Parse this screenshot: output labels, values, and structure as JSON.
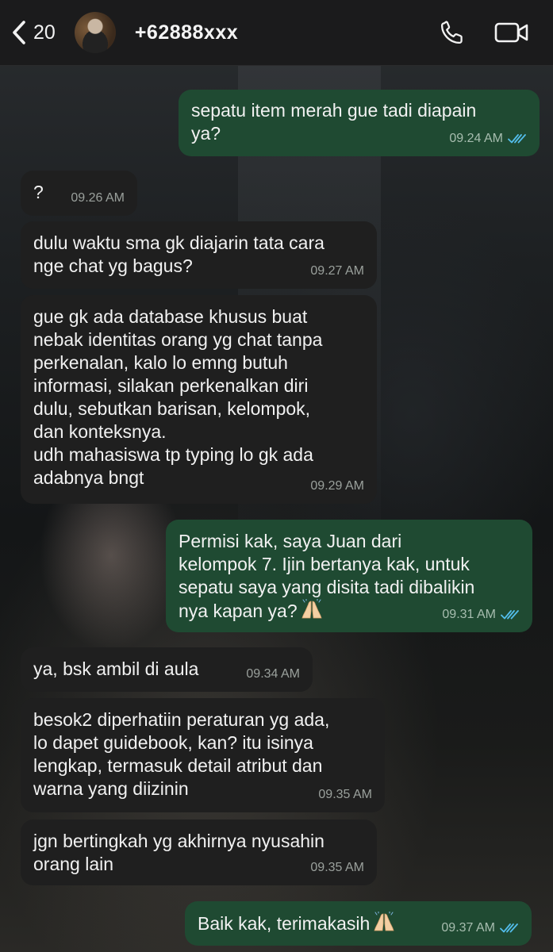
{
  "header": {
    "back_count": "20",
    "contact_name": "+62888xxx"
  },
  "messages": [
    {
      "direction": "out",
      "text": "sepatu item merah gue tadi diapain\nya?",
      "time": "09.24 AM"
    },
    {
      "direction": "in",
      "text": "?",
      "time": "09.26 AM"
    },
    {
      "direction": "in",
      "text": "dulu waktu sma gk diajarin tata cara\nnge chat yg bagus?",
      "time": "09.27 AM"
    },
    {
      "direction": "in",
      "text": "gue gk ada database khusus buat\nnebak identitas orang yg chat tanpa\nperkenalan, kalo lo emng butuh\ninformasi, silakan perkenalkan diri\ndulu, sebutkan barisan, kelompok,\ndan konteksnya.\nudh mahasiswa tp typing lo gk ada\nadabnya bngt",
      "time": "09.29 AM"
    },
    {
      "direction": "out",
      "text": "Permisi kak, saya Juan dari\nkelompok 7. Ijin bertanya kak, untuk\nsepatu saya yang disita tadi dibalikin\nnya kapan ya?",
      "emoji": "folded-hands",
      "time": "09.31 AM"
    },
    {
      "direction": "in",
      "text": "ya, bsk ambil di aula",
      "time": "09.34 AM"
    },
    {
      "direction": "in",
      "text": "besok2 diperhatiin peraturan yg ada,\nlo dapet guidebook, kan? itu isinya\nlengkap, termasuk detail atribut dan\nwarna yang diizinin",
      "time": "09.35 AM"
    },
    {
      "direction": "in",
      "text": "jgn bertingkah yg akhirnya nyusahin\norang lain",
      "time": "09.35 AM"
    },
    {
      "direction": "out",
      "text": "Baik kak, terimakasih",
      "emoji": "folded-hands",
      "time": "09.37 AM"
    }
  ],
  "colors": {
    "incoming_bubble": "#1f1f1f",
    "outgoing_bubble": "#1f4a32",
    "read_ticks": "#53bdeb"
  },
  "icons": [
    "chevron-left-icon",
    "phone-icon",
    "video-camera-icon",
    "double-check-icon",
    "folded-hands-emoji"
  ]
}
